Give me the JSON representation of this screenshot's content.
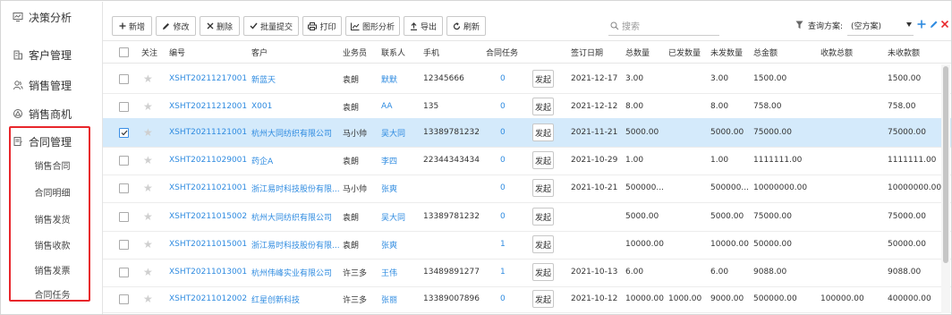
{
  "sidebar": {
    "items": [
      {
        "label": "决策分析",
        "icon": "monitor-icon"
      },
      {
        "label": "客户管理",
        "icon": "building-icon"
      },
      {
        "label": "销售管理",
        "icon": "user-group-icon"
      },
      {
        "label": "销售商机",
        "icon": "opportunity-icon"
      },
      {
        "label": "合同管理",
        "icon": "contract-icon"
      }
    ],
    "sub_items": [
      "销售合同",
      "合同明细",
      "销售发货",
      "销售收款",
      "销售发票",
      "合同任务"
    ],
    "highlight_color": "#e8262b"
  },
  "toolbar": {
    "buttons": [
      "新增",
      "修改",
      "删除",
      "批量提交",
      "打印",
      "图形分析",
      "导出",
      "刷新"
    ],
    "search_placeholder": "搜索",
    "scheme_label": "查询方案:",
    "scheme_value": "(空方案)"
  },
  "table": {
    "headers": [
      "关注",
      "编号",
      "客户",
      "业务员",
      "联系人",
      "手机",
      "合同任务",
      "签订日期",
      "总数量",
      "已发数量",
      "未发数量",
      "总金额",
      "收款总额",
      "未收款额"
    ],
    "launch_label": "发起",
    "rows": [
      {
        "id": "XSHT20211217001",
        "customer": "新蓝天",
        "salesman": "袁朗",
        "contact": "默默",
        "phone": "12345666",
        "task": "0",
        "date": "2021-12-17",
        "total_qty": "3.00",
        "sent_qty": "",
        "unsent_qty": "3.00",
        "total_amt": "1500.00",
        "received": "",
        "unreceived": "1500.00",
        "selected": false
      },
      {
        "id": "XSHT20211212001",
        "customer": "X001",
        "salesman": "袁朗",
        "contact": "AA",
        "phone": "135",
        "task": "0",
        "date": "2021-12-12",
        "total_qty": "8.00",
        "sent_qty": "",
        "unsent_qty": "8.00",
        "total_amt": "758.00",
        "received": "",
        "unreceived": "758.00",
        "selected": false
      },
      {
        "id": "XSHT20211121001",
        "customer": "杭州大同纺织有限公司",
        "salesman": "马小帅",
        "contact": "吴大同",
        "phone": "13389781232",
        "task": "0",
        "date": "2021-11-21",
        "total_qty": "5000.00",
        "sent_qty": "",
        "unsent_qty": "5000.00",
        "total_amt": "75000.00",
        "received": "",
        "unreceived": "75000.00",
        "selected": true
      },
      {
        "id": "XSHT20211029001",
        "customer": "药企A",
        "salesman": "袁朗",
        "contact": "李四",
        "phone": "22344343434",
        "task": "0",
        "date": "2021-10-29",
        "total_qty": "1.00",
        "sent_qty": "",
        "unsent_qty": "1.00",
        "total_amt": "1111111.00",
        "received": "",
        "unreceived": "1111111.00",
        "selected": false
      },
      {
        "id": "XSHT20211021001",
        "customer": "浙江易时科技股份有限...",
        "salesman": "马小帅",
        "contact": "张爽",
        "phone": "",
        "task": "0",
        "date": "2021-10-21",
        "total_qty": "500000...",
        "sent_qty": "",
        "unsent_qty": "500000...",
        "total_amt": "10000000.00",
        "received": "",
        "unreceived": "10000000.00",
        "selected": false
      },
      {
        "id": "XSHT20211015002",
        "customer": "杭州大同纺织有限公司",
        "salesman": "袁朗",
        "contact": "吴大同",
        "phone": "13389781232",
        "task": "0",
        "date": "",
        "total_qty": "5000.00",
        "sent_qty": "",
        "unsent_qty": "5000.00",
        "total_amt": "75000.00",
        "received": "",
        "unreceived": "75000.00",
        "selected": false
      },
      {
        "id": "XSHT20211015001",
        "customer": "浙江易时科技股份有限...",
        "salesman": "袁朗",
        "contact": "张爽",
        "phone": "",
        "task": "1",
        "date": "",
        "total_qty": "10000.00",
        "sent_qty": "",
        "unsent_qty": "10000.00",
        "total_amt": "50000.00",
        "received": "",
        "unreceived": "50000.00",
        "selected": false
      },
      {
        "id": "XSHT20211013001",
        "customer": "杭州伟峰实业有限公司",
        "salesman": "许三多",
        "contact": "王伟",
        "phone": "13489891277",
        "task": "1",
        "date": "2021-10-13",
        "total_qty": "6.00",
        "sent_qty": "",
        "unsent_qty": "6.00",
        "total_amt": "9088.00",
        "received": "",
        "unreceived": "9088.00",
        "selected": false
      },
      {
        "id": "XSHT20211012002",
        "customer": "红星创新科技",
        "salesman": "许三多",
        "contact": "张丽",
        "phone": "13389007896",
        "task": "0",
        "date": "2021-10-12",
        "total_qty": "10000.00",
        "sent_qty": "1000.00",
        "unsent_qty": "9000.00",
        "total_amt": "500000.00",
        "received": "100000.00",
        "unreceived": "400000.00",
        "selected": false
      }
    ]
  },
  "colors": {
    "link": "#2f8be0",
    "selected_row": "#d4eafb",
    "accent_blue": "#2f8be0",
    "close_red": "#e8262b"
  }
}
